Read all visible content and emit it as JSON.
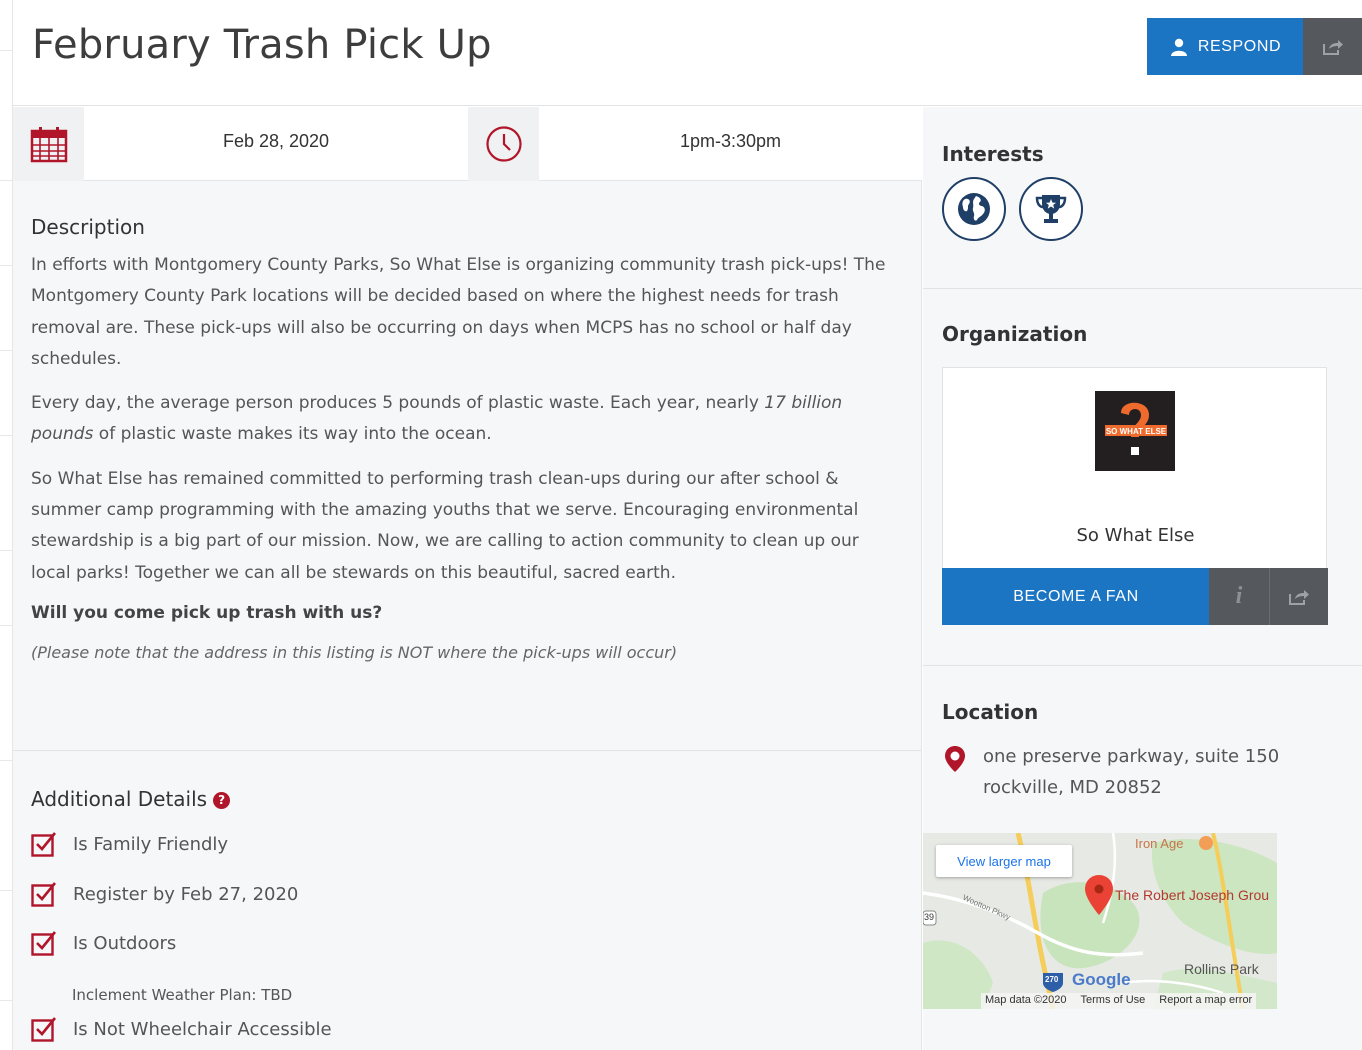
{
  "event": {
    "title": "February Trash Pick Up",
    "respond_label": "RESPOND",
    "date": "Feb 28, 2020",
    "time": "1pm-3:30pm"
  },
  "description": {
    "heading": "Description",
    "para1": "In efforts with Montgomery County Parks, So What Else is organizing community trash pick-ups! The Montgomery County Park locations will be decided based on where the highest needs for trash removal are. These pick-ups will also be occurring on days when MCPS has no school or half day schedules.",
    "para2_before": "Every day, the average person produces 5 pounds of plastic waste. Each year, nearly ",
    "para2_emph": "17 billion pounds",
    "para2_after": " of plastic waste makes its way into the ocean.",
    "para3": "So What Else has remained committed to performing trash clean-ups during our after school & summer camp programming with the amazing youths that we serve. Encouraging environmental stewardship is a big part of our mission. Now, we are calling to action community to clean up our local parks! Together we can all be stewards on this beautiful, sacred earth.",
    "question": "Will you come pick up trash with us?",
    "note": "(Please note that the address in this listing is NOT where the pick-ups will occur)"
  },
  "details": {
    "heading": "Additional Details",
    "help_glyph": "?",
    "items": [
      "Is Family Friendly",
      "Register by Feb 27, 2020",
      "Is Outdoors",
      "Is Not Wheelchair Accessible"
    ],
    "weather_note": "Inclement Weather Plan: TBD"
  },
  "sidebar": {
    "interests_heading": "Interests",
    "interests": [
      "globe-icon",
      "trophy-icon"
    ],
    "organization_heading": "Organization",
    "org_name": "So What Else",
    "org_logo_text": "SO WHAT ELSE",
    "become_fan_label": "BECOME A FAN",
    "info_glyph": "i",
    "location_heading": "Location",
    "address_line1": "one preserve parkway, suite 150",
    "address_line2": "rockville, MD 20852"
  },
  "map": {
    "view_larger": "View larger map",
    "place_iron_age": "Iron Age",
    "place_robert_joseph": "The Robert Joseph Grou",
    "place_rollins": "Rollins Park",
    "road_label": "Wootton Pkwy",
    "route_shield": "270",
    "route_small": "39",
    "google": "Google",
    "map_data": "Map data ©2020",
    "terms": "Terms of Use",
    "report": "Report a map error"
  },
  "colors": {
    "primary_blue": "#1b75c3",
    "dark_gray": "#55595d",
    "accent_red": "#b0152a",
    "interest_navy": "#1f3f66"
  }
}
